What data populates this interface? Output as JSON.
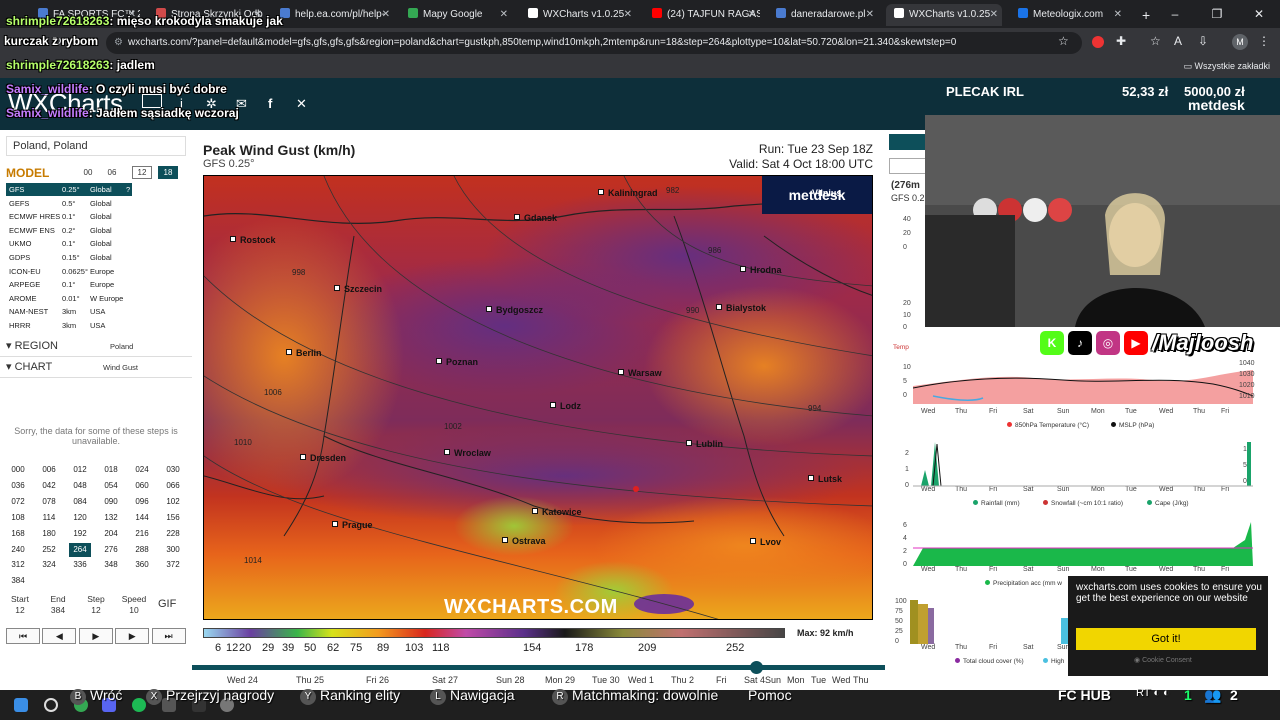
{
  "browser": {
    "tabs": [
      {
        "label": "FA SPORTS FC™ 26",
        "color": "#4a7bd0"
      },
      {
        "label": "Strona Skrzynki Odb",
        "color": "#d04a4a"
      },
      {
        "label": "help.ea.com/pl/help-",
        "color": "#4a7bd0"
      },
      {
        "label": "Mapy Google",
        "color": "#34a853"
      },
      {
        "label": "WXCharts v1.0.25",
        "color": "#ffffff"
      },
      {
        "label": "(24) TAJFUN RAGASA",
        "color": "#ff0000"
      },
      {
        "label": "daneradarowe.pl",
        "color": "#4a7bd0"
      },
      {
        "label": "WXCharts v1.0.25",
        "color": "#ffffff"
      },
      {
        "label": "Meteologix.com",
        "color": "#1a73e8"
      }
    ],
    "new_tab": "+",
    "url": "wxcharts.com/?panel=default&model=gfs,gfs,gfs,gfs&region=poland&chart=gustkph,850temp,wind10mkph,2mtemp&run=18&step=264&plottype=10&lat=50.720&lon=21.340&skewtstep=0",
    "bookmarks_all": "Wszystkie zakładki",
    "profile_letter": "M"
  },
  "chat": [
    {
      "user": "shrimple72618263",
      "text": ": mięso krokodyla smakuje jak"
    },
    {
      "user": "kurczak z rybom",
      "text": ""
    },
    {
      "user": "shrimple72618263",
      "text": ": jadlem"
    },
    {
      "user": "Samix_wildlife",
      "text": ": O czyli musi być dobre"
    },
    {
      "user": "Samix_wildlife",
      "text": ": Jadłem sąsiadkę wczoraj"
    }
  ],
  "wx": {
    "logo": "WXCharts",
    "location": "Poland, Poland",
    "model_title": "MODEL",
    "runs": [
      "00",
      "06",
      "12",
      "18"
    ],
    "models": [
      {
        "name": "GFS",
        "res": "0.25°",
        "area": "Global",
        "extra": "?"
      },
      {
        "name": "GEFS",
        "res": "0.5°",
        "area": "Global",
        "extra": ""
      },
      {
        "name": "ECMWF HRES",
        "res": "0.1°",
        "area": "Global",
        "extra": ""
      },
      {
        "name": "ECMWF ENS",
        "res": "0.2°",
        "area": "Global",
        "extra": ""
      },
      {
        "name": "UKMO",
        "res": "0.1°",
        "area": "Global",
        "extra": ""
      },
      {
        "name": "GDPS",
        "res": "0.15°",
        "area": "Global",
        "extra": ""
      },
      {
        "name": "ICON-EU",
        "res": "0.0625°",
        "area": "Europe",
        "extra": ""
      },
      {
        "name": "ARPEGE",
        "res": "0.1°",
        "area": "Europe",
        "extra": ""
      },
      {
        "name": "AROME",
        "res": "0.01°",
        "area": "W Europe",
        "extra": ""
      },
      {
        "name": "NAM-NEST",
        "res": "3km",
        "area": "USA",
        "extra": ""
      },
      {
        "name": "HRRR",
        "res": "3km",
        "area": "USA",
        "extra": ""
      }
    ],
    "region_label": "▾ REGION",
    "region_value": "Poland",
    "chart_label": "▾ CHART",
    "chart_value": "Wind Gust",
    "unavailable": "Sorry, the data for some of these steps is unavailable.",
    "steps": [
      "000",
      "006",
      "012",
      "018",
      "024",
      "030",
      "036",
      "042",
      "048",
      "054",
      "060",
      "066",
      "072",
      "078",
      "084",
      "090",
      "096",
      "102",
      "108",
      "114",
      "120",
      "132",
      "144",
      "156",
      "168",
      "180",
      "192",
      "204",
      "216",
      "228",
      "240",
      "252",
      "264",
      "276",
      "288",
      "300",
      "312",
      "324",
      "336",
      "348",
      "360",
      "372",
      "384"
    ],
    "selected_step": "264",
    "controls": [
      {
        "label": "Start",
        "value": "12"
      },
      {
        "label": "End",
        "value": "384"
      },
      {
        "label": "Step",
        "value": "12"
      },
      {
        "label": "Speed",
        "value": "10"
      }
    ],
    "gif": "GIF",
    "play_controls": [
      "⏮",
      "◀",
      "▶",
      "▶",
      "⏭"
    ]
  },
  "map": {
    "title": "Peak Wind Gust (km/h)",
    "subtitle": "GFS 0.25°",
    "run": "Run: Tue 23 Sep 18Z",
    "valid": "Valid: Sat 4 Oct 18:00 UTC",
    "watermark": "WXCHARTS.COM",
    "badge": "metdesk",
    "badge_city": "Vilnius",
    "cities": [
      "Kaliningrad",
      "Gdansk",
      "Rostock",
      "Hrodna",
      "Szczecin",
      "Bydgoszcz",
      "Bialystok",
      "Berlin",
      "Poznan",
      "Warsaw",
      "Lodz",
      "Lublin",
      "Dresden",
      "Wroclaw",
      "Lutsk",
      "Katowice",
      "Prague",
      "Ostrava",
      "Lvov"
    ],
    "isobars": [
      "982",
      "986",
      "990",
      "994",
      "998",
      "1002",
      "1006",
      "1010",
      "1014"
    ],
    "scale_labels": [
      "6",
      "12",
      "20",
      "29",
      "39",
      "50",
      "62",
      "75",
      "89",
      "103",
      "118",
      "154",
      "178",
      "209",
      "252"
    ],
    "max_label": "Max: 92 km/h",
    "timeline_days": [
      "Wed 24",
      "Thu 25",
      "Fri 26",
      "Sat 27",
      "Sun 28",
      "Mon 29",
      "Tue 30",
      "Wed 1",
      "Thu 2",
      "Fri 3",
      "Sat 4",
      "Sun 5",
      "Mon 6",
      "Tue 7",
      "Wed 8",
      "Thu 9"
    ]
  },
  "meteogram": {
    "title_partial": "(276m",
    "model_partial": "GFS 0.2",
    "days": [
      "Wed",
      "Thu",
      "Fri",
      "Sat",
      "Sun",
      "Mon",
      "Tue",
      "Wed",
      "Thu",
      "Fri"
    ],
    "legend_temp": "Temp",
    "legend_850": "850hPa Temperature (°C)",
    "legend_mslp": "MSLP (hPa)",
    "legend_rain": "Rainfall (mm)",
    "legend_snow": "Snowfall (~cm 10:1 ratio)",
    "legend_cape": "Cape (J/kg)",
    "legend_precip": "Precipitation acc (mm w",
    "legend_cloud": "Total cloud cover (%)",
    "legend_high": "High",
    "y_mslp": [
      "1040",
      "1030",
      "1020",
      "1010"
    ],
    "y_850": [
      "10",
      "5",
      "0"
    ],
    "y_rain": [
      "2",
      "1",
      "0"
    ],
    "y_cape": [
      "10",
      "5",
      "0"
    ],
    "y_precip": [
      "6",
      "4",
      "2",
      "0"
    ],
    "y_cloud": [
      "100",
      "75",
      "50",
      "25",
      "0"
    ],
    "y_top": [
      "40",
      "20",
      "0"
    ],
    "y_top2": [
      "20",
      "10",
      "0"
    ]
  },
  "stream": {
    "plecak": "PLECAK IRL",
    "val1": "52,33 zł",
    "val2": "5000,00 zł",
    "metdesk": "metdesk",
    "handle": "/Majloosh",
    "social": [
      {
        "glyph": "K",
        "color": "#53fc18"
      },
      {
        "glyph": "♪",
        "color": "#000000"
      },
      {
        "glyph": "◎",
        "color": "#c13584"
      },
      {
        "glyph": "▶",
        "color": "#ff0000"
      }
    ]
  },
  "cookie": {
    "text": "wxcharts.com uses cookies to ensure you get the best experience on our website",
    "button": "Got it!",
    "consent": "Cookie Consent"
  },
  "hud": {
    "items": [
      {
        "key": "B",
        "label": "Wróć"
      },
      {
        "key": "X",
        "label": "Przejrzyj nagrody"
      },
      {
        "key": "Y",
        "label": "Ranking elity"
      },
      {
        "key": "L",
        "label": "Nawigacja"
      },
      {
        "key": "R",
        "label": "Matchmaking: dowolnie"
      },
      {
        "key": "",
        "label": "Pomoc"
      }
    ],
    "fc_hub": "FC HUB",
    "count1": "1",
    "count2": "2"
  }
}
